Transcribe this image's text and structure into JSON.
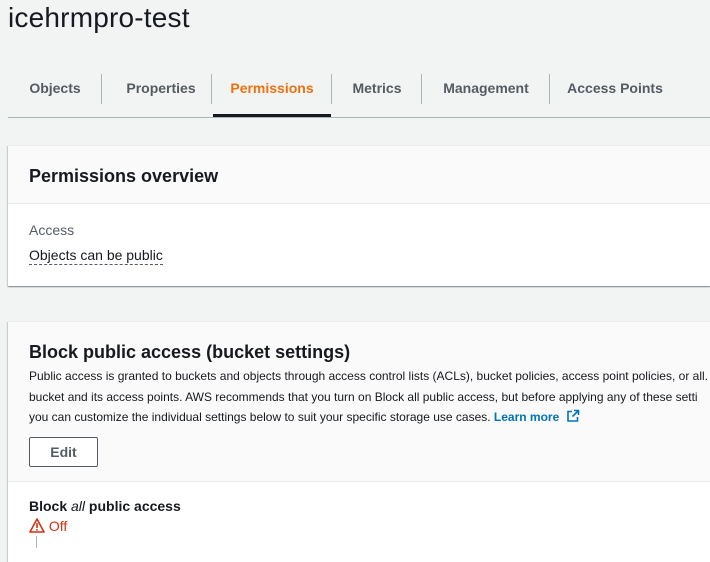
{
  "page": {
    "title": "icehrmpro-test"
  },
  "tabs": [
    {
      "label": "Objects"
    },
    {
      "label": "Properties"
    },
    {
      "label": "Permissions"
    },
    {
      "label": "Metrics"
    },
    {
      "label": "Management"
    },
    {
      "label": "Access Points"
    }
  ],
  "active_tab": "Permissions",
  "overview": {
    "title": "Permissions overview",
    "access_label": "Access",
    "access_value": "Objects can be public"
  },
  "block_public_access": {
    "title": "Block public access (bucket settings)",
    "description_line1": "Public access is granted to buckets and objects through access control lists (ACLs), bucket policies, access point policies, or all.",
    "description_line2": "bucket and its access points. AWS recommends that you turn on Block all public access, but before applying any of these setti",
    "description_line3": "you can customize the individual settings below to suit your specific storage use cases.",
    "learn_more": "Learn more",
    "edit_label": "Edit",
    "setting_prefix": "Block ",
    "setting_emphasis": "all",
    "setting_suffix": " public access",
    "status": "Off"
  },
  "colors": {
    "accent": "#ec7211",
    "link": "#0073bb",
    "error": "#d13212"
  },
  "icons": {
    "external_link": "external-link-icon",
    "warning": "warning-icon"
  }
}
